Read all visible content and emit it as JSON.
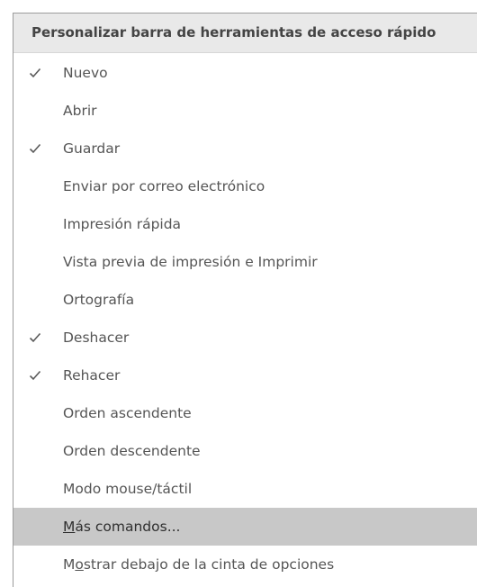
{
  "menu": {
    "title": "Personalizar barra de herramientas de acceso rápido",
    "check_icon": "checkmark-icon",
    "items": [
      {
        "label": "Nuevo",
        "checked": true
      },
      {
        "label": "Abrir",
        "checked": false
      },
      {
        "label": "Guardar",
        "checked": true
      },
      {
        "label": "Enviar por correo electrónico",
        "checked": false
      },
      {
        "label": "Impresión rápida",
        "checked": false
      },
      {
        "label": "Vista previa de impresión e Imprimir",
        "checked": false
      },
      {
        "label": "Ortografía",
        "checked": false
      },
      {
        "label": "Deshacer",
        "checked": true
      },
      {
        "label": "Rehacer",
        "checked": true
      },
      {
        "label": "Orden ascendente",
        "checked": false
      },
      {
        "label": "Orden descendente",
        "checked": false
      },
      {
        "label": "Modo mouse/táctil",
        "checked": false
      }
    ],
    "more_commands": {
      "pre": "",
      "accel": "M",
      "post": "ás comandos..."
    },
    "show_below": {
      "pre": "M",
      "accel": "o",
      "post": "strar debajo de la cinta de opciones"
    }
  }
}
